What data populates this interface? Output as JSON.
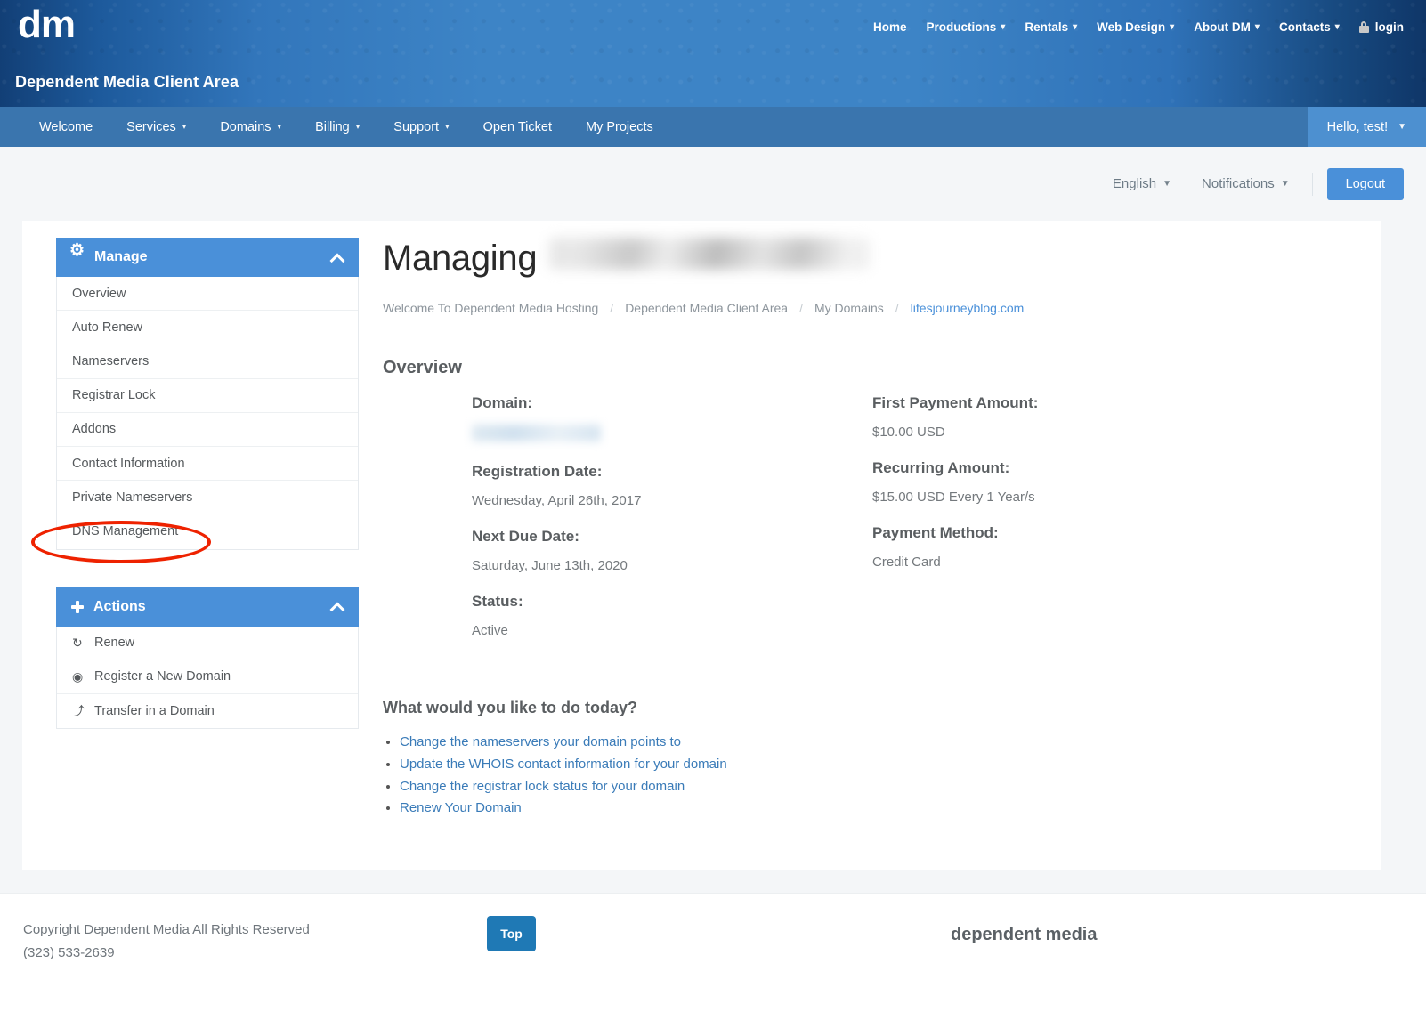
{
  "brand": {
    "logo": "dm",
    "subtitle": "Dependent Media Client Area",
    "footer_brand": "dependent media",
    "accent_blue": "#4a90d9",
    "header_blue": "#3d84c6",
    "nav_blue": "#3a75ae",
    "annotation_red": "#ee2200"
  },
  "top_nav": {
    "items": [
      {
        "label": "Home",
        "caret": false
      },
      {
        "label": "Productions",
        "caret": true
      },
      {
        "label": "Rentals",
        "caret": true
      },
      {
        "label": "Web Design",
        "caret": true
      },
      {
        "label": "About DM",
        "caret": true
      },
      {
        "label": "Contacts",
        "caret": true
      }
    ],
    "login": {
      "label": "login",
      "icon": "lock-icon"
    }
  },
  "client_nav": {
    "items": [
      {
        "label": "Welcome",
        "caret": false
      },
      {
        "label": "Services",
        "caret": true
      },
      {
        "label": "Domains",
        "caret": true
      },
      {
        "label": "Billing",
        "caret": true
      },
      {
        "label": "Support",
        "caret": true
      },
      {
        "label": "Open Ticket",
        "caret": false
      },
      {
        "label": "My Projects",
        "caret": false
      }
    ],
    "user_menu": "Hello, test!"
  },
  "utility_bar": {
    "language": "English",
    "notifications": "Notifications",
    "logout": "Logout"
  },
  "sidebar": {
    "manage": {
      "title": "Manage",
      "icon": "gear-icon",
      "collapse_icon": "chevron-up-icon",
      "items": [
        {
          "label": "Overview"
        },
        {
          "label": "Auto Renew"
        },
        {
          "label": "Nameservers"
        },
        {
          "label": "Registrar Lock"
        },
        {
          "label": "Addons"
        },
        {
          "label": "Contact Information"
        },
        {
          "label": "Private Nameservers"
        },
        {
          "label": "DNS Management"
        }
      ]
    },
    "actions": {
      "title": "Actions",
      "icon": "plus-icon",
      "collapse_icon": "chevron-up-icon",
      "items": [
        {
          "label": "Renew",
          "icon": "refresh-icon",
          "glyph": "↻"
        },
        {
          "label": "Register a New Domain",
          "icon": "globe-icon",
          "glyph": "◉"
        },
        {
          "label": "Transfer in a Domain",
          "icon": "arrow-curve-icon",
          "glyph": "⤴"
        }
      ]
    }
  },
  "main": {
    "title_prefix": "Managing",
    "title_domain_redacted": true,
    "breadcrumb": [
      {
        "label": "Welcome To Dependent Media Hosting",
        "link": false
      },
      {
        "label": "Dependent Media Client Area",
        "link": false
      },
      {
        "label": "My Domains",
        "link": false
      },
      {
        "label": "lifesjourneyblog.com",
        "link": true
      }
    ],
    "breadcrumb_separator": "/",
    "overview_heading": "Overview",
    "details_left": [
      {
        "term": "Domain:",
        "value": "",
        "redacted": true
      },
      {
        "term": "Registration Date:",
        "value": "Wednesday, April 26th, 2017",
        "redacted": false
      },
      {
        "term": "Next Due Date:",
        "value": "Saturday, June 13th, 2020",
        "redacted": false
      },
      {
        "term": "Status:",
        "value": "Active",
        "redacted": false
      }
    ],
    "details_right": [
      {
        "term": "First Payment Amount:",
        "value": "$10.00 USD"
      },
      {
        "term": "Recurring Amount:",
        "value": "$15.00 USD Every 1 Year/s"
      },
      {
        "term": "Payment Method:",
        "value": "Credit Card"
      }
    ],
    "todo_heading": "What would you like to do today?",
    "todo_links": [
      "Change the nameservers your domain points to",
      "Update the WHOIS contact information for your domain",
      "Change the registrar lock status for your domain",
      "Renew Your Domain"
    ]
  },
  "footer": {
    "copyright_line1": "Copyright Dependent Media All Rights Reserved",
    "copyright_line2": "(323) 533-2639",
    "top_button": "Top"
  }
}
